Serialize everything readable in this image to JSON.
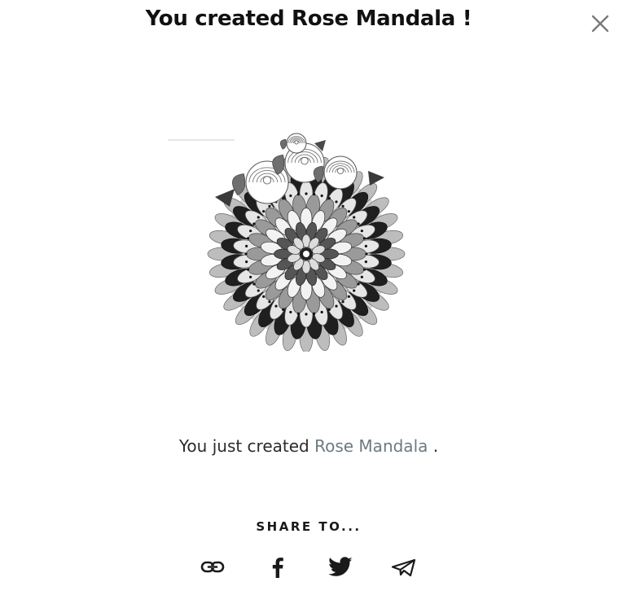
{
  "dialog": {
    "title": "You created Rose Mandala !",
    "close_icon": "close-icon",
    "artwork_icon": "rose-mandala-artwork"
  },
  "message": {
    "prefix": "You just created ",
    "link_text": "Rose Mandala",
    "suffix": " ."
  },
  "share": {
    "label": "SHARE TO...",
    "icons": [
      "link-icon",
      "facebook-icon",
      "twitter-icon",
      "telegram-icon"
    ]
  },
  "colors": {
    "title": "#111111",
    "link": "#6d7a80",
    "icon": "#1a1a1a",
    "close": "#7a7a7a"
  }
}
